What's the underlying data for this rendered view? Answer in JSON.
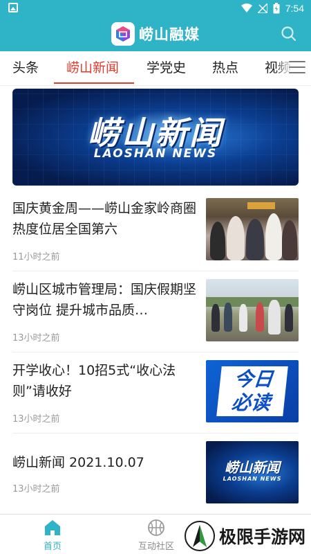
{
  "status_bar": {
    "time": "7:54"
  },
  "header": {
    "app_name": "崂山融媒"
  },
  "tabs": [
    {
      "label": "头条"
    },
    {
      "label": "崂山新闻"
    },
    {
      "label": "学党史"
    },
    {
      "label": "热点"
    },
    {
      "label": "视频"
    }
  ],
  "active_tab": "崂山新闻",
  "banner": {
    "title": "崂山新闻",
    "subtitle": "LAOSHAN NEWS"
  },
  "news": [
    {
      "title": "国庆黄金周——崂山金家岭商圈热度位居全国第六",
      "time": "11小时之前"
    },
    {
      "title": "崂山区城市管理局：国庆假期坚守岗位 提升城市品质…",
      "time": "13小时之前"
    },
    {
      "title": "开学收心！10招5式“收心法则”请收好",
      "time": "13小时之前"
    },
    {
      "title": "崂山新闻 2021.10.07",
      "time": "13小时之前"
    }
  ],
  "thumb_text": {
    "today_line1": "今日",
    "today_line2": "必读",
    "news_title": "崂山新闻",
    "news_sub": "LAOSHAN NEWS"
  },
  "bottom_nav": [
    {
      "label": "首页",
      "icon": "home-icon"
    },
    {
      "label": "互动社区",
      "icon": "basketball-icon"
    }
  ],
  "watermark": {
    "text": "极限手游网"
  },
  "colors": {
    "brand": "#2fb3c6",
    "accent": "#e23a2e"
  }
}
